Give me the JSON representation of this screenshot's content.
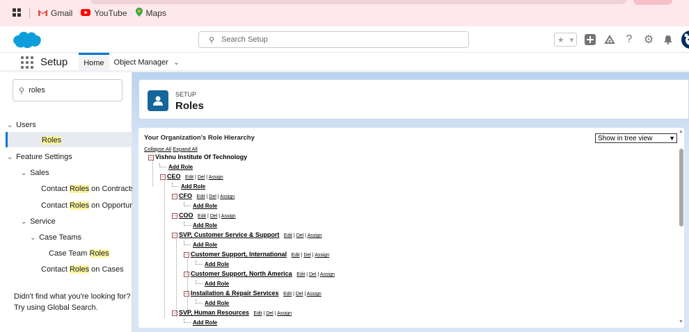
{
  "bookmarks": {
    "items": [
      {
        "label": "Gmail"
      },
      {
        "label": "YouTube"
      },
      {
        "label": "Maps"
      }
    ]
  },
  "global_header": {
    "search_placeholder": "Search Setup"
  },
  "nav": {
    "app_name": "Setup",
    "tabs": [
      {
        "label": "Home"
      },
      {
        "label": "Object Manager"
      }
    ]
  },
  "sidebar": {
    "quick_find_value": "roles",
    "items": {
      "users": "Users",
      "roles": "Roles",
      "feature_settings": "Feature Settings",
      "sales": "Sales",
      "contact_roles_contracts_pre": "Contact ",
      "contact_roles_contracts_hl": "Roles",
      "contact_roles_contracts_post": " on Contracts",
      "contact_roles_opps_pre": "Contact ",
      "contact_roles_opps_hl": "Roles",
      "contact_roles_opps_post": " on Opportunities",
      "service": "Service",
      "case_teams": "Case Teams",
      "case_team_roles_pre": "Case Team ",
      "case_team_roles_hl": "Roles",
      "contact_roles_cases_pre": "Contact ",
      "contact_roles_cases_hl": "Roles",
      "contact_roles_cases_post": " on Cases"
    },
    "no_result_line1": "Didn't find what you're looking for?",
    "no_result_line2": "Try using Global Search."
  },
  "page_header": {
    "eyebrow": "SETUP",
    "title": "Roles"
  },
  "hierarchy": {
    "title": "Your Organization's Role Hierarchy",
    "view_select": "Show in tree view",
    "collapse_all": "Collapse All",
    "expand_all": "Expand All",
    "org": "Vishnu Institute Of Technology",
    "add_role": "Add Role",
    "edit": "Edit",
    "del": "Del",
    "assign": "Assign",
    "sep": "|",
    "roles": {
      "ceo": "CEO",
      "cfo": "CFO",
      "coo": "COO",
      "svp_cs": "SVP, Customer Service & Support",
      "cs_intl": "Customer Support, International",
      "cs_na": "Customer Support, North America",
      "install": "Installation & Repair Services",
      "svp_hr": "SVP, Human Resources"
    }
  },
  "colors": {
    "brand": "#0176d3",
    "bookmark_bar": "#fde8ec",
    "highlight": "#fbf4a0",
    "header_icon": "#15669b"
  }
}
